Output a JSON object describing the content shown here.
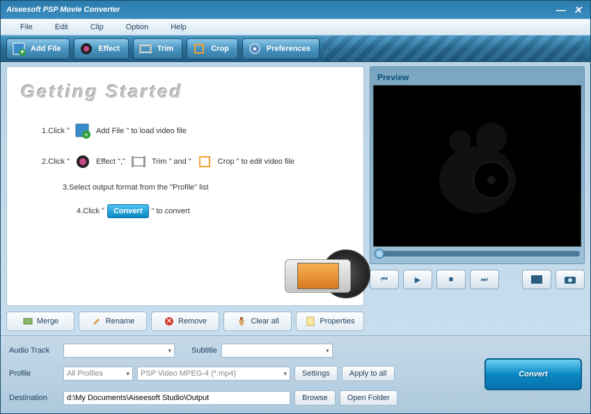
{
  "window": {
    "title": "Aiseesoft PSP Movie Converter"
  },
  "menu": {
    "file": "File",
    "edit": "Edit",
    "clip": "Clip",
    "option": "Option",
    "help": "Help"
  },
  "toolbar": {
    "add_file": "Add File",
    "effect": "Effect",
    "trim": "Trim",
    "crop": "Crop",
    "preferences": "Preferences"
  },
  "getting_started": {
    "title": "Getting Started",
    "step1_pre": "1.Click \" ",
    "step1_mid": " Add File \" to load video file",
    "step2_pre": "2.Click \" ",
    "step2_effect": " Effect \",\" ",
    "step2_trim": " Trim \" and \" ",
    "step2_crop": " Crop \" to edit video file",
    "step3": "3.Select output format from the \"Profile\" list",
    "step4_pre": "4.Click \" ",
    "step4_convert": "Convert",
    "step4_post": " \" to convert"
  },
  "actions": {
    "merge": "Merge",
    "rename": "Rename",
    "remove": "Remove",
    "clear_all": "Clear all",
    "properties": "Properties"
  },
  "preview": {
    "label": "Preview"
  },
  "form": {
    "audio_track_label": "Audio Track",
    "audio_track_value": "",
    "subtitle_label": "Subtitle",
    "subtitle_value": "",
    "profile_label": "Profile",
    "profile_category": "All Profiles",
    "profile_format": "PSP Video MPEG-4 (*.mp4)",
    "destination_label": "Destination",
    "destination_value": "d:\\My Documents\\Aiseesoft Studio\\Output",
    "settings": "Settings",
    "apply_to_all": "Apply to all",
    "browse": "Browse",
    "open_folder": "Open Folder"
  },
  "convert": {
    "label": "Convert"
  }
}
